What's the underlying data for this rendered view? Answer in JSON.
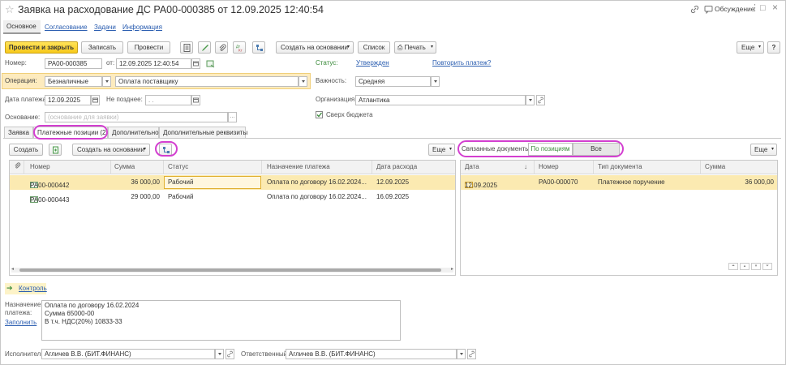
{
  "window": {
    "title": "Заявка на расходование ДС РА00-000385 от 12.09.2025 12:40:54",
    "discussion_label": "Обсуждение"
  },
  "nav_tabs": [
    "Основное",
    "Согласование",
    "Задачи",
    "Информация"
  ],
  "toolbar": {
    "post_close": "Провести и закрыть",
    "save": "Записать",
    "post": "Провести",
    "create_based": "Создать на основании",
    "list": "Список",
    "print": "Печать",
    "more": "Еще"
  },
  "form": {
    "number_label": "Номер:",
    "number_value": "РА00-000385",
    "from_label": "от:",
    "from_value": "12.09.2025 12:40:54",
    "status_label": "Статус:",
    "status_value": "Утвержден",
    "repeat_link": "Повторить платеж?",
    "operation_label": "Операция:",
    "operation_value": "Безналичные",
    "operation_kind": "Оплата поставщику",
    "importance_label": "Важность:",
    "importance_value": "Средняя",
    "pay_date_label": "Дата платежа:",
    "pay_date_value": "12.09.2025",
    "not_later_label": "Не позднее:",
    "not_later_value": ". .",
    "org_label": "Организация:",
    "org_value": "Атлантика",
    "over_budget_label": "Сверх бюджета",
    "basis_label": "Основание:",
    "basis_placeholder": "(основание для заявки)"
  },
  "tabs": [
    "Заявка",
    "Платежные позиции (2)",
    "Дополнительно",
    "Дополнительные реквизиты"
  ],
  "left_toolbar": {
    "create": "Создать",
    "create_based": "Создать на основании",
    "more": "Еще"
  },
  "left_grid": {
    "headers": [
      "Номер",
      "Сумма",
      "Статус",
      "Назначение платежа",
      "Дата расхода"
    ],
    "rows": [
      {
        "number": "РА00-000442",
        "sum": "36 000,00",
        "status": "Рабочий",
        "purpose": "Оплата по договору 16.02.2024...",
        "date": "12.09.2025"
      },
      {
        "number": "РА00-000443",
        "sum": "29 000,00",
        "status": "Рабочий",
        "purpose": "Оплата по договору 16.02.2024...",
        "date": "16.09.2025"
      }
    ]
  },
  "right_toolbar": {
    "related_label": "Связанные документы",
    "by_positions": "По позициям",
    "all": "Все",
    "more": "Еще"
  },
  "right_grid": {
    "headers": [
      "Дата",
      "Номер",
      "Тип документа",
      "Сумма"
    ],
    "rows": [
      {
        "date": "12.09.2025",
        "number": "РА00-000070",
        "type": "Платежное поручение",
        "sum": "36 000,00"
      }
    ]
  },
  "control_link": "Контроль",
  "purpose": {
    "label_line1": "Назначение",
    "label_line2": "платежа:",
    "fill_link": "Заполнить",
    "line1": "Оплата по договору 16.02.2024",
    "line2": "Сумма 65000-00",
    "line3": "В т.ч. НДС(20%) 10833-33"
  },
  "footer": {
    "executor_label": "Исполнитель:",
    "executor_value": "Агличев В.В. (БИТ.ФИНАНС)",
    "responsible_label": "Ответственный:",
    "responsible_value": "Агличев В.В. (БИТ.ФИНАНС)"
  },
  "colors": {
    "primary_button": "#f7c91b",
    "selected_row": "#fbeab1",
    "highlight_oval": "#d33fd0",
    "link": "#2a5db0"
  }
}
